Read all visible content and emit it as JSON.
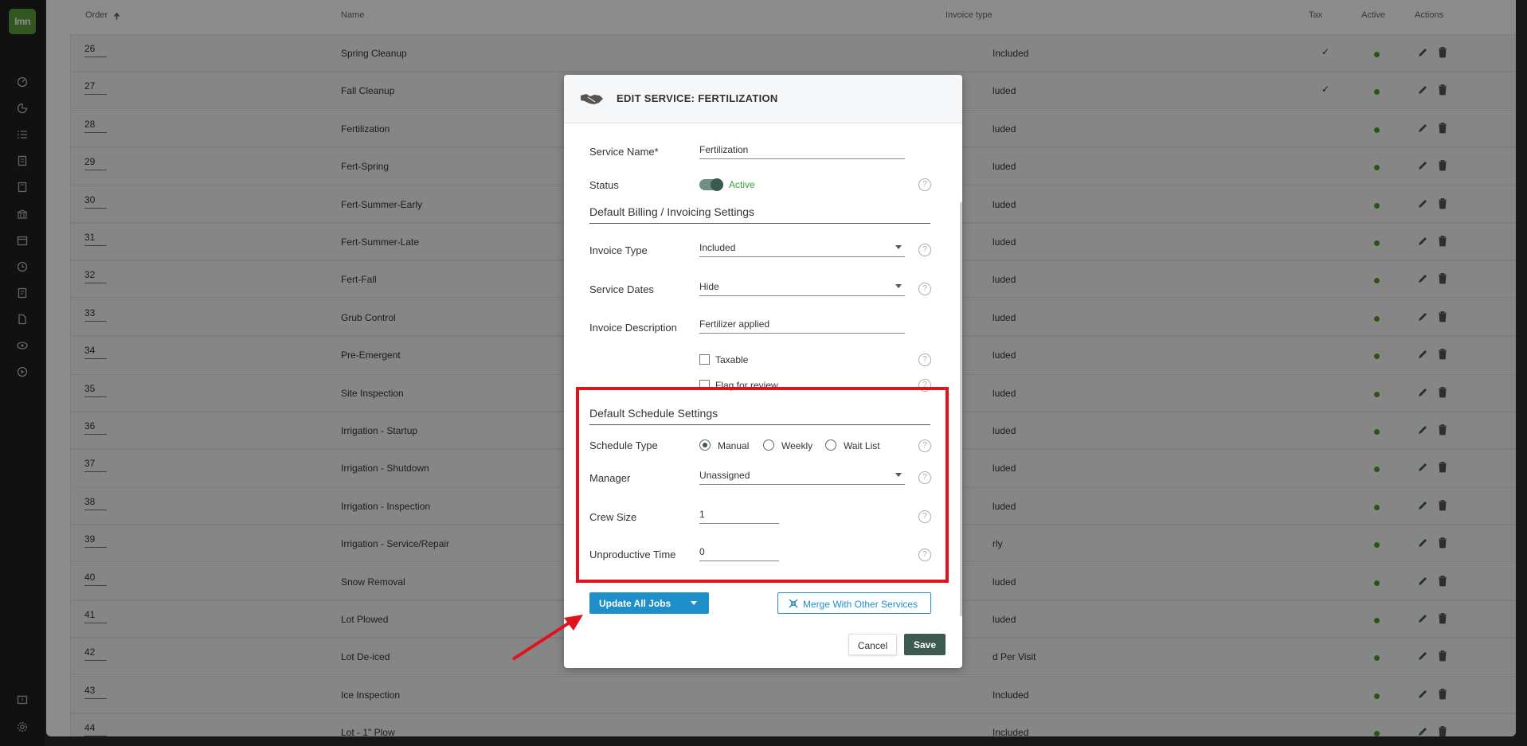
{
  "app": {
    "logo_text": "lmn"
  },
  "sidebar": {
    "icons": [
      "dashboard-icon",
      "pie-chart-icon",
      "list-icon",
      "clipboard-icon",
      "document-icon",
      "building-icon",
      "calendar-icon",
      "clock-icon",
      "invoice-icon",
      "file-icon",
      "eye-icon",
      "play-icon",
      "feedback-icon",
      "gear-icon"
    ]
  },
  "list": {
    "headers": {
      "order": "Order",
      "name": "Name",
      "invoice_type": "Invoice type",
      "tax": "Tax",
      "active": "Active",
      "actions": "Actions"
    },
    "rows": [
      {
        "order": "26",
        "name": "Spring Cleanup",
        "invoice": "Included",
        "tax": "✓"
      },
      {
        "order": "27",
        "name": "Fall Cleanup",
        "invoice": "luded",
        "tax": "✓"
      },
      {
        "order": "28",
        "name": "Fertilization",
        "invoice": "luded",
        "tax": ""
      },
      {
        "order": "29",
        "name": "Fert-Spring",
        "invoice": "luded",
        "tax": ""
      },
      {
        "order": "30",
        "name": "Fert-Summer-Early",
        "invoice": "luded",
        "tax": ""
      },
      {
        "order": "31",
        "name": "Fert-Summer-Late",
        "invoice": "luded",
        "tax": ""
      },
      {
        "order": "32",
        "name": "Fert-Fall",
        "invoice": "luded",
        "tax": ""
      },
      {
        "order": "33",
        "name": "Grub Control",
        "invoice": "luded",
        "tax": ""
      },
      {
        "order": "34",
        "name": "Pre-Emergent",
        "invoice": "luded",
        "tax": ""
      },
      {
        "order": "35",
        "name": "Site Inspection",
        "invoice": "luded",
        "tax": ""
      },
      {
        "order": "36",
        "name": "Irrigation - Startup",
        "invoice": "luded",
        "tax": ""
      },
      {
        "order": "37",
        "name": "Irrigation - Shutdown",
        "invoice": "luded",
        "tax": ""
      },
      {
        "order": "38",
        "name": "Irrigation - Inspection",
        "invoice": "luded",
        "tax": ""
      },
      {
        "order": "39",
        "name": "Irrigation - Service/Repair",
        "invoice": "rly",
        "tax": ""
      },
      {
        "order": "40",
        "name": "Snow Removal",
        "invoice": "luded",
        "tax": ""
      },
      {
        "order": "41",
        "name": "Lot Plowed",
        "invoice": "luded",
        "tax": ""
      },
      {
        "order": "42",
        "name": "Lot De-iced",
        "invoice": "d Per Visit",
        "tax": ""
      },
      {
        "order": "43",
        "name": "Ice Inspection",
        "invoice": "Included",
        "tax": ""
      },
      {
        "order": "44",
        "name": "Lot - 1\" Plow",
        "invoice": "Included",
        "tax": ""
      }
    ]
  },
  "modal": {
    "title": "EDIT SERVICE: FERTILIZATION",
    "service_name_label": "Service Name*",
    "service_name_value": "Fertilization",
    "status_label": "Status",
    "status_value": "Active",
    "billing_section": "Default Billing / Invoicing Settings",
    "invoice_type_label": "Invoice Type",
    "invoice_type_value": "Included",
    "service_dates_label": "Service Dates",
    "service_dates_value": "Hide",
    "invoice_desc_label": "Invoice Description",
    "invoice_desc_value": "Fertilizer applied",
    "taxable_label": "Taxable",
    "flag_label": "Flag for review",
    "schedule_section": "Default Schedule Settings",
    "schedule_type_label": "Schedule Type",
    "schedule_options": [
      "Manual",
      "Weekly",
      "Wait List"
    ],
    "schedule_selected": "Manual",
    "manager_label": "Manager",
    "manager_value": "Unassigned",
    "crew_size_label": "Crew Size",
    "crew_size_value": "1",
    "unproductive_label": "Unproductive Time",
    "unproductive_value": "0",
    "help_glyph": "?",
    "update_button": "Update All Jobs",
    "merge_button": "Merge With Other Services",
    "cancel_button": "Cancel",
    "save_button": "Save"
  },
  "colors": {
    "brand_green": "#5e9e3c",
    "dark_green": "#3c5a50",
    "blue": "#1f8fc9",
    "highlight_red": "#e0121c",
    "active_dot": "#4d9a2c"
  }
}
